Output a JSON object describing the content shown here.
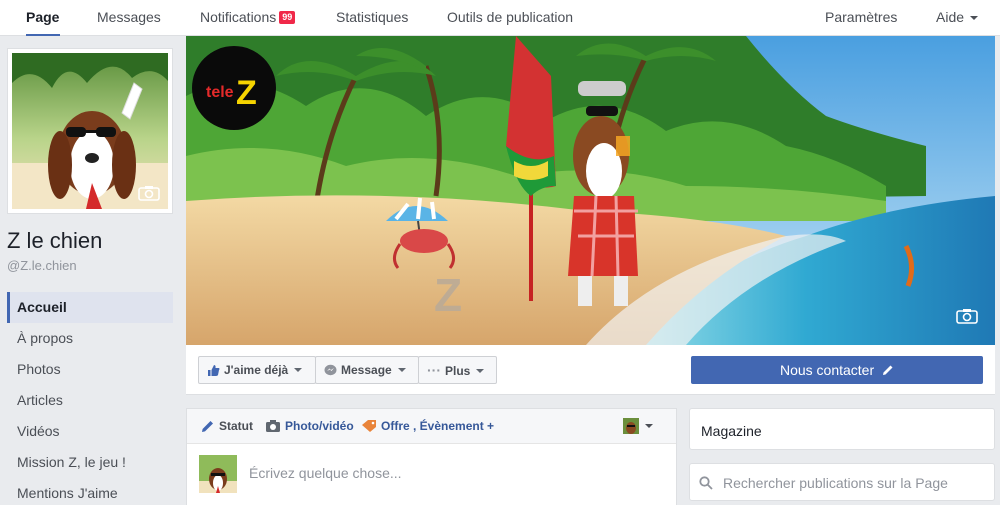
{
  "topnav": {
    "page": "Page",
    "messages": "Messages",
    "notifications": "Notifications",
    "notifications_badge": "99",
    "stats": "Statistiques",
    "publishing": "Outils de publication",
    "settings": "Paramètres",
    "help": "Aide"
  },
  "profile": {
    "name": "Z le chien",
    "handle": "@Z.le.chien"
  },
  "leftnav": {
    "items": [
      "Accueil",
      "À propos",
      "Photos",
      "Articles",
      "Vidéos",
      "Mission Z, le jeu !",
      "Mentions J'aime"
    ]
  },
  "cover": {
    "logo_text_1": "tele",
    "logo_text_2": "Z"
  },
  "actions": {
    "liked": "J'aime déjà",
    "message": "Message",
    "more": "Plus",
    "contact": "Nous contacter"
  },
  "composer": {
    "status": "Statut",
    "photo": "Photo/vidéo",
    "offer": "Offre , Évènement +",
    "placeholder": "Écrivez quelque chose..."
  },
  "right": {
    "magazine": "Magazine",
    "search_placeholder": "Rechercher publications sur la Page"
  },
  "colors": {
    "brand_blue": "#4267b2",
    "badge_red": "#f02849",
    "link_blue": "#365899"
  }
}
